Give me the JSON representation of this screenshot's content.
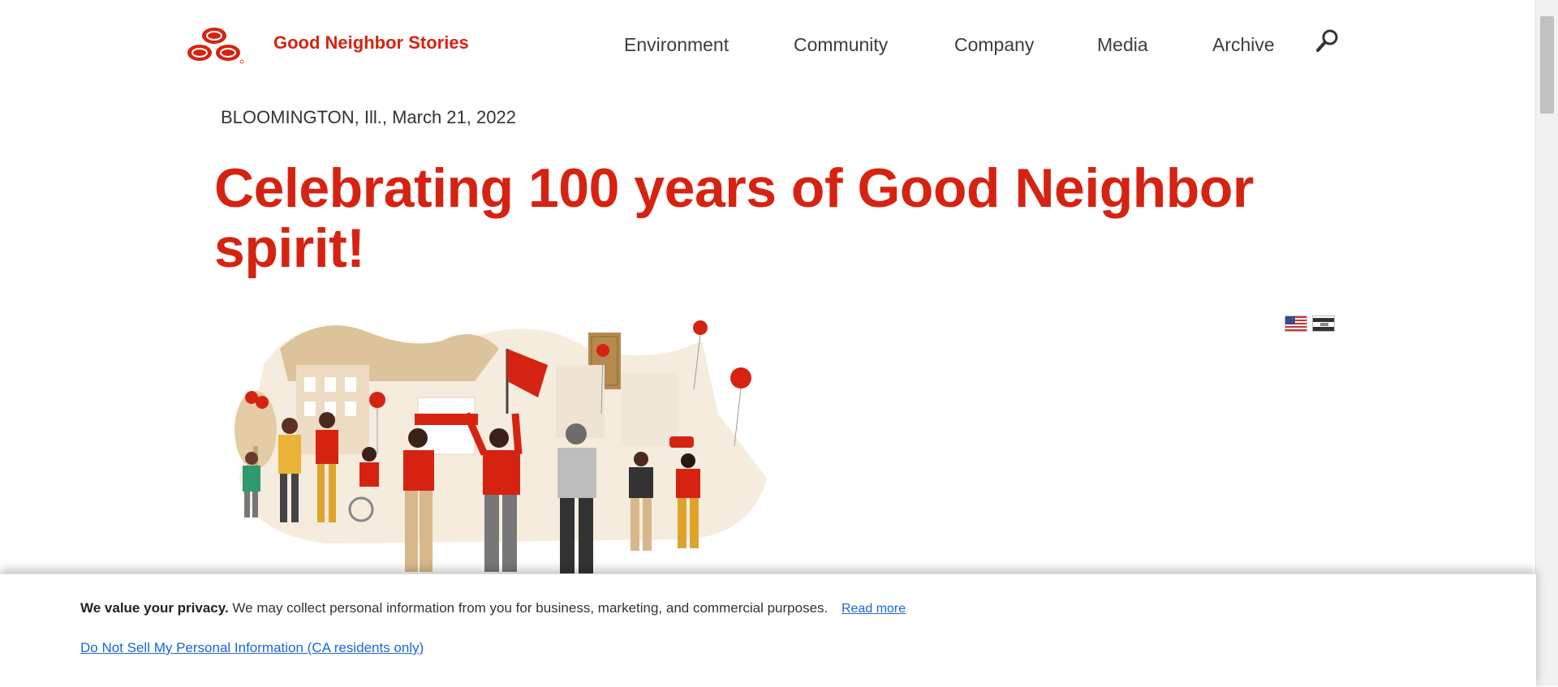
{
  "header": {
    "brand": "Good Neighbor Stories",
    "nav": [
      "Environment",
      "Community",
      "Company",
      "Media",
      "Archive"
    ]
  },
  "article": {
    "dateline": "BLOOMINGTON, Ill., March 21, 2022",
    "headline": "Celebrating 100 years of Good Neighbor spirit!"
  },
  "cookie_banner": {
    "lead": "We value your privacy.",
    "text": " We may collect personal information from you for business, marketing, and commercial purposes.",
    "read_more": "Read more",
    "do_not_sell": "Do Not Sell My Personal Information (CA residents only)"
  },
  "colors": {
    "brand_red": "#d62311",
    "link_blue": "#1a66d8"
  },
  "icons": [
    "state-farm-logo",
    "search-icon",
    "us-flag-icon",
    "alt-language-flag-icon"
  ]
}
